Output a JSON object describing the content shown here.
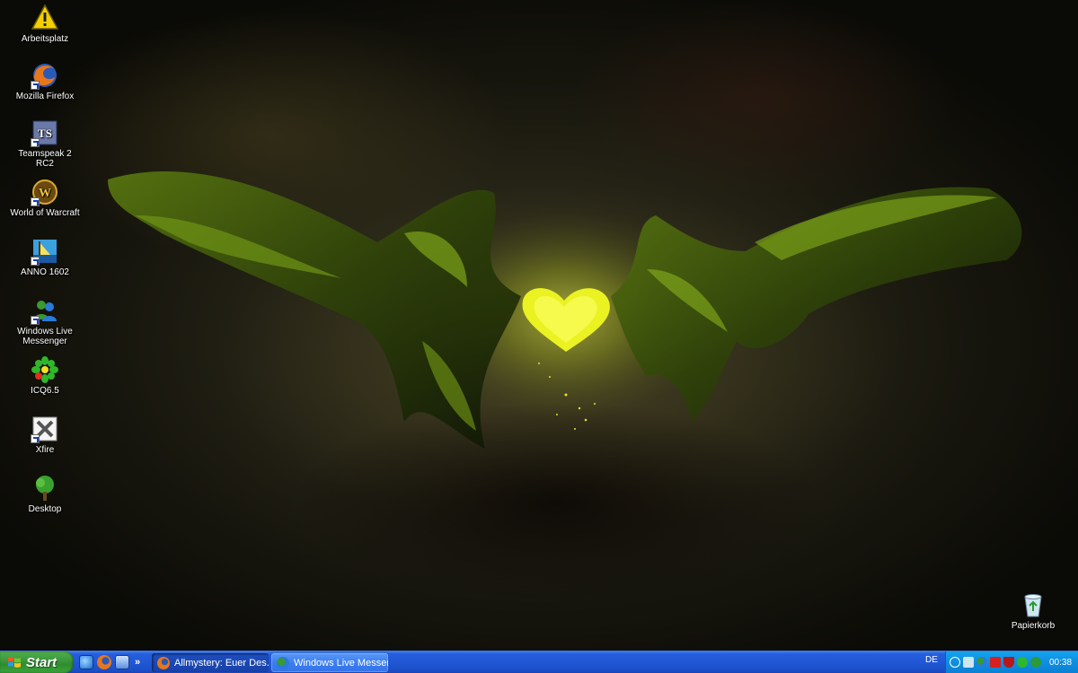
{
  "desktop_icons": [
    {
      "label": "Arbeitsplatz",
      "icon": "warning-icon"
    },
    {
      "label": "Mozilla Firefox",
      "icon": "firefox-icon"
    },
    {
      "label": "Teamspeak 2 RC2",
      "icon": "teamspeak-icon"
    },
    {
      "label": "World of Warcraft",
      "icon": "warcraft-icon"
    },
    {
      "label": "ANNO 1602",
      "icon": "anno-icon"
    },
    {
      "label": "Windows Live Messenger",
      "icon": "messenger-icon"
    },
    {
      "label": "ICQ6.5",
      "icon": "icq-flower-icon"
    },
    {
      "label": "Xfire",
      "icon": "xfire-icon"
    },
    {
      "label": "Desktop",
      "icon": "tree-icon"
    }
  ],
  "recycle_bin": {
    "label": "Papierkorb",
    "icon": "recycle-bin-icon"
  },
  "taskbar": {
    "start_label": "Start",
    "quick_launch": [
      "ie-icon",
      "firefox-icon",
      "explorer-icon"
    ],
    "quick_launch_more": "»",
    "tasks": [
      {
        "label": "Allmystery: Euer Des...",
        "icon": "firefox-icon",
        "active": true
      },
      {
        "label": "Windows Live Messen...",
        "icon": "messenger-icon",
        "active": false
      }
    ],
    "language": "DE",
    "clock": "00:38"
  },
  "colors": {
    "taskbar_blue": "#245edc",
    "start_green": "#3c9a3c",
    "tray_blue": "#0f8ee0",
    "heart_glow": "#e8f21a"
  }
}
